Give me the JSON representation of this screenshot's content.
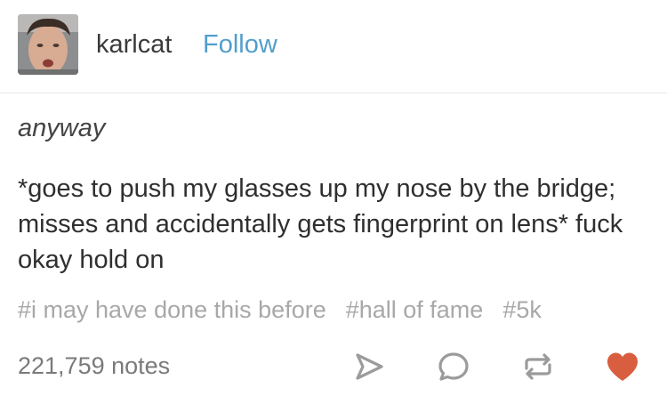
{
  "post": {
    "username": "karlcat",
    "follow_label": "Follow",
    "title": "anyway",
    "body": "*goes to push my glasses up my nose by the bridge; misses and accidentally gets fingerprint on lens* fuck okay hold on",
    "tags": [
      "#i may have done this before",
      "#hall of fame",
      "#5k"
    ],
    "notes": "221,759 notes"
  },
  "icons": {
    "share": "share-icon",
    "reply": "reply-icon",
    "reblog": "reblog-icon",
    "like": "heart-icon"
  },
  "colors": {
    "follow": "#529ecc",
    "tag": "#a8a8a8",
    "action_icon": "#9b9b9b",
    "like": "#d95e40"
  }
}
